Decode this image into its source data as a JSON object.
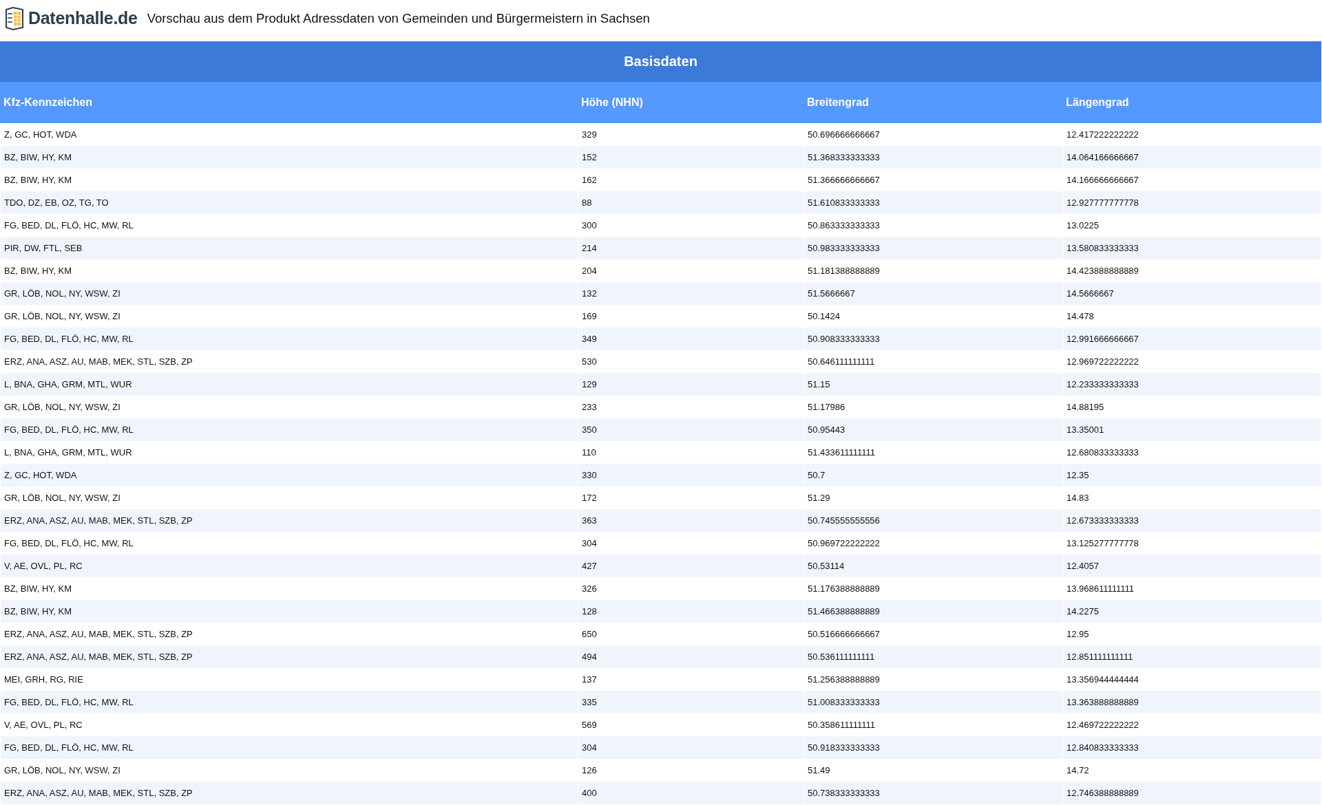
{
  "header": {
    "logo_text": "Datenhalle.de",
    "subtitle": "Vorschau aus dem Produkt Adressdaten von Gemeinden und Bürgermeistern in Sachsen"
  },
  "table": {
    "title": "Basisdaten",
    "columns": [
      "Kfz-Kennzeichen",
      "Höhe (NHN)",
      "Breitengrad",
      "Längengrad"
    ],
    "rows": [
      [
        "Z, GC, HOT, WDA",
        "329",
        "50.696666666667",
        "12.417222222222"
      ],
      [
        "BZ, BIW, HY, KM",
        "152",
        "51.368333333333",
        "14.064166666667"
      ],
      [
        "BZ, BIW, HY, KM",
        "162",
        "51.366666666667",
        "14.166666666667"
      ],
      [
        "TDO, DZ, EB, OZ, TG, TO",
        "88",
        "51.610833333333",
        "12.927777777778"
      ],
      [
        "FG, BED, DL, FLÖ, HC, MW, RL",
        "300",
        "50.863333333333",
        "13.0225"
      ],
      [
        "PIR, DW, FTL, SEB",
        "214",
        "50.983333333333",
        "13.580833333333"
      ],
      [
        "BZ, BIW, HY, KM",
        "204",
        "51.181388888889",
        "14.423888888889"
      ],
      [
        "GR, LÖB, NOL, NY, WSW, ZI",
        "132",
        "51.5666667",
        "14.5666667"
      ],
      [
        "GR, LÖB, NOL, NY, WSW, ZI",
        "169",
        "50.1424",
        "14.478"
      ],
      [
        "FG, BED, DL, FLÖ, HC, MW, RL",
        "349",
        "50.908333333333",
        "12.991666666667"
      ],
      [
        "ERZ, ANA, ASZ, AU, MAB, MEK, STL, SZB, ZP",
        "530",
        "50.646111111111",
        "12.969722222222"
      ],
      [
        "L, BNA, GHA, GRM, MTL, WUR",
        "129",
        "51.15",
        "12.233333333333"
      ],
      [
        "GR, LÖB, NOL, NY, WSW, ZI",
        "233",
        "51.17986",
        "14.88195"
      ],
      [
        "FG, BED, DL, FLÖ, HC, MW, RL",
        "350",
        "50.95443",
        "13.35001"
      ],
      [
        "L, BNA, GHA, GRM, MTL, WUR",
        "110",
        "51.433611111111",
        "12.680833333333"
      ],
      [
        "Z, GC, HOT, WDA",
        "330",
        "50.7",
        "12.35"
      ],
      [
        "GR, LÖB, NOL, NY, WSW, ZI",
        "172",
        "51.29",
        "14.83"
      ],
      [
        "ERZ, ANA, ASZ, AU, MAB, MEK, STL, SZB, ZP",
        "363",
        "50.745555555556",
        "12.673333333333"
      ],
      [
        "FG, BED, DL, FLÖ, HC, MW, RL",
        "304",
        "50.969722222222",
        "13.125277777778"
      ],
      [
        "V, AE, OVL, PL, RC",
        "427",
        "50.53114",
        "12.4057"
      ],
      [
        "BZ, BIW, HY, KM",
        "326",
        "51.176388888889",
        "13.968611111111"
      ],
      [
        "BZ, BIW, HY, KM",
        "128",
        "51.466388888889",
        "14.2275"
      ],
      [
        "ERZ, ANA, ASZ, AU, MAB, MEK, STL, SZB, ZP",
        "650",
        "50.516666666667",
        "12.95"
      ],
      [
        "ERZ, ANA, ASZ, AU, MAB, MEK, STL, SZB, ZP",
        "494",
        "50.536111111111",
        "12.851111111111"
      ],
      [
        "MEI, GRH, RG, RIE",
        "137",
        "51.256388888889",
        "13.356944444444"
      ],
      [
        "FG, BED, DL, FLÖ, HC, MW, RL",
        "335",
        "51.008333333333",
        "13.363888888889"
      ],
      [
        "V, AE, OVL, PL, RC",
        "569",
        "50.358611111111",
        "12.469722222222"
      ],
      [
        "FG, BED, DL, FLÖ, HC, MW, RL",
        "304",
        "50.918333333333",
        "12.840833333333"
      ],
      [
        "GR, LÖB, NOL, NY, WSW, ZI",
        "126",
        "51.49",
        "14.72"
      ],
      [
        "ERZ, ANA, ASZ, AU, MAB, MEK, STL, SZB, ZP",
        "400",
        "50.738333333333",
        "12.746388888889"
      ]
    ]
  }
}
